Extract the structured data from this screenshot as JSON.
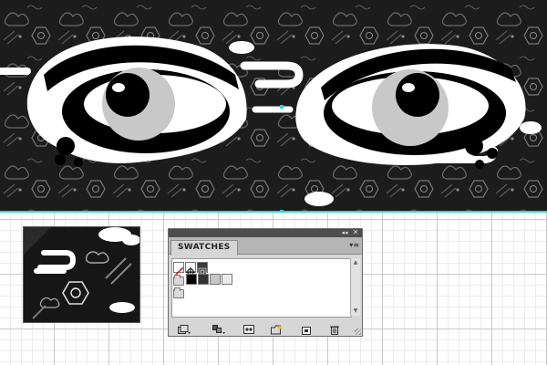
{
  "panel": {
    "tab_label": "SWATCHES",
    "collapse_glyph": "◂◂",
    "close_glyph": "✕",
    "menu_glyph": "▾≡"
  },
  "scrollbar": {
    "up_glyph": "▲",
    "down_glyph": "▼"
  },
  "swatches": {
    "row1": [
      {
        "name": "none-swatch",
        "color": "#ffffff"
      },
      {
        "name": "registration-swatch",
        "color": "#ffffff"
      },
      {
        "name": "pattern-swatch",
        "color": "#3a3a3a"
      }
    ],
    "row2": [
      {
        "name": "black-swatch",
        "color": "#000000"
      },
      {
        "name": "dark-gray-swatch",
        "color": "#333333"
      },
      {
        "name": "light-gray-swatch",
        "color": "#c6c6c6"
      },
      {
        "name": "near-white-swatch",
        "color": "#ebebeb"
      }
    ]
  },
  "toolbar": {
    "icons": [
      "swatch-libraries-menu-icon",
      "show-swatch-kinds-icon",
      "swatch-options-icon",
      "new-color-group-icon",
      "new-swatch-icon",
      "delete-swatch-icon"
    ]
  },
  "colors": {
    "artwork_bg": "#1c1c1c",
    "guide": "#33d4d8",
    "panel_bg": "#d6d6d6",
    "iris": "#c8c8c8"
  }
}
